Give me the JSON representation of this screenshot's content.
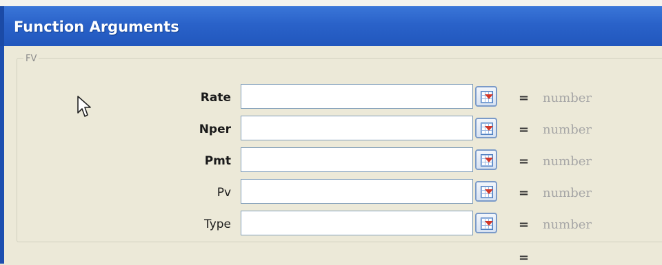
{
  "window": {
    "title": "Function Arguments"
  },
  "group": {
    "legend": "FV"
  },
  "arguments": [
    {
      "label": "Rate",
      "bold": true,
      "value": "",
      "result": "number"
    },
    {
      "label": "Nper",
      "bold": true,
      "value": "",
      "result": "number"
    },
    {
      "label": "Pmt",
      "bold": true,
      "value": "",
      "result": "number"
    },
    {
      "label": "Pv",
      "bold": false,
      "value": "",
      "result": "number"
    },
    {
      "label": "Type",
      "bold": false,
      "value": "",
      "result": "number"
    }
  ],
  "equals_sign": "=",
  "icons": {
    "collapse_button": "collapse-dialog-icon",
    "cursor": "mouse-pointer-icon"
  }
}
